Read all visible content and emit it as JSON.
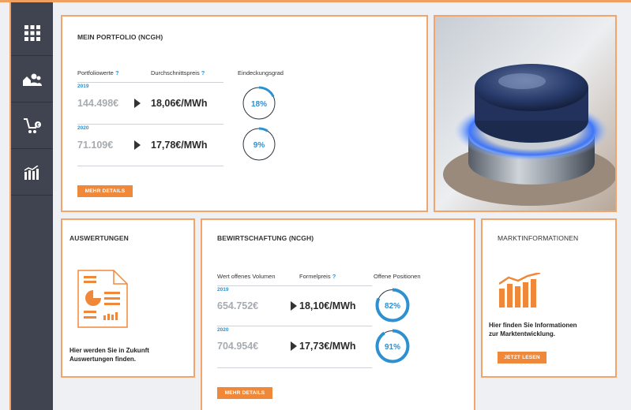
{
  "sidebar": {
    "items": [
      {
        "icon": "grid-icon"
      },
      {
        "icon": "users-icon"
      },
      {
        "icon": "cart-icon"
      },
      {
        "icon": "bar-chart-icon"
      }
    ]
  },
  "portfolio": {
    "title": "MEIN PORTFOLIO (NCGH)",
    "col1_label": "Portfoliowerte",
    "col2_label": "Durchschnittspreis",
    "col3_label": "Eindeckungsgrad",
    "help": "?",
    "rows": [
      {
        "year": "2019",
        "value": "144.498€",
        "price": "18,06€/MWh",
        "percent_label": "18%",
        "percent": 18
      },
      {
        "year": "2020",
        "value": "71.109€",
        "price": "17,78€/MWh",
        "percent_label": "9%",
        "percent": 9
      }
    ],
    "button": "MEHR DETAILS"
  },
  "auswertungen": {
    "title": "AUSWERTUNGEN",
    "text_line1": "Hier werden Sie in Zukunft",
    "text_line2": "Auswertungen finden."
  },
  "bewirtschaftung": {
    "title": "BEWIRTSCHAFTUNG (NCGH)",
    "col1_label": "Wert offenes Volumen",
    "col2_label": "Formelpreis",
    "col3_label": "Offene Positionen",
    "help": "?",
    "rows": [
      {
        "year": "2019",
        "value": "654.752€",
        "price": "18,10€/MWh",
        "percent_label": "82%",
        "percent": 82
      },
      {
        "year": "2020",
        "value": "704.954€",
        "price": "17,73€/MWh",
        "percent_label": "91%",
        "percent": 91
      }
    ],
    "button": "MEHR DETAILS"
  },
  "marktinfo": {
    "title": "MARKTINFORMATIONEN",
    "text_line1": "Hier finden Sie Informationen",
    "text_line2": "zur Marktentwicklung.",
    "button": "JETZT LESEN"
  },
  "colors": {
    "accent": "#f0883a",
    "border": "#f2a46a",
    "blue": "#2d90d0",
    "sidebar": "#3f4450"
  }
}
